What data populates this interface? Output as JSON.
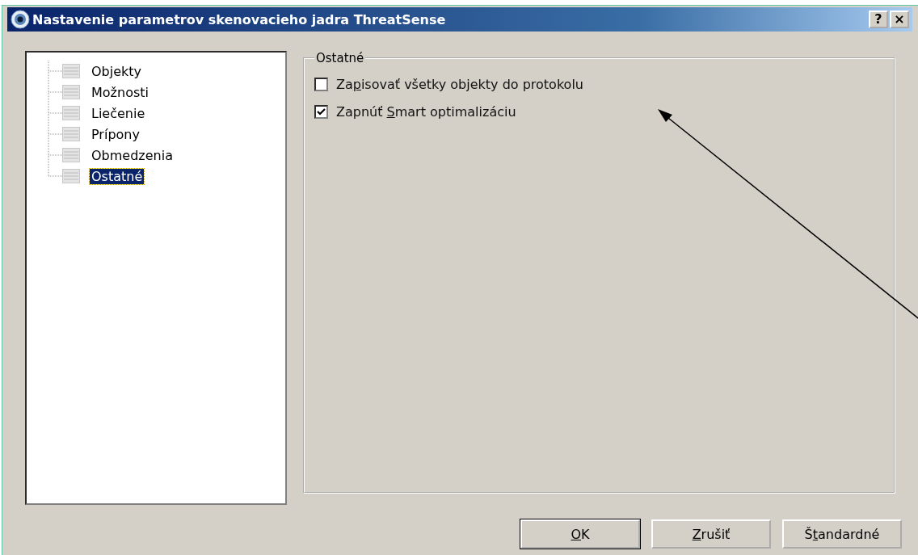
{
  "window": {
    "title": "Nastavenie parametrov skenovacieho jadra ThreatSense",
    "title_buttons": [
      "?",
      "×"
    ]
  },
  "tree": [
    {
      "label": "Objekty",
      "selected": false
    },
    {
      "label": "Možnosti",
      "selected": false
    },
    {
      "label": "Liečenie",
      "selected": false
    },
    {
      "label": "Prípony",
      "selected": false
    },
    {
      "label": "Obmedzenia",
      "selected": false
    },
    {
      "label": "Ostatné",
      "selected": true
    }
  ],
  "group": {
    "title": "Ostatné",
    "options": [
      {
        "label_before": "Za",
        "access_key": "p",
        "label_after": "isovať všetky objekty do protokolu",
        "checked": false
      },
      {
        "label_before": "Zapnúť ",
        "access_key": "S",
        "label_after": "mart optimalizáciu",
        "checked": true
      }
    ]
  },
  "buttons": [
    {
      "access_key": "O",
      "label_after": "K",
      "default": true
    },
    {
      "access_key": "Z",
      "label_after": "rušiť",
      "default": false
    },
    {
      "label_before": "Š",
      "access_key": "t",
      "label_after": "andardné",
      "default": false
    }
  ]
}
